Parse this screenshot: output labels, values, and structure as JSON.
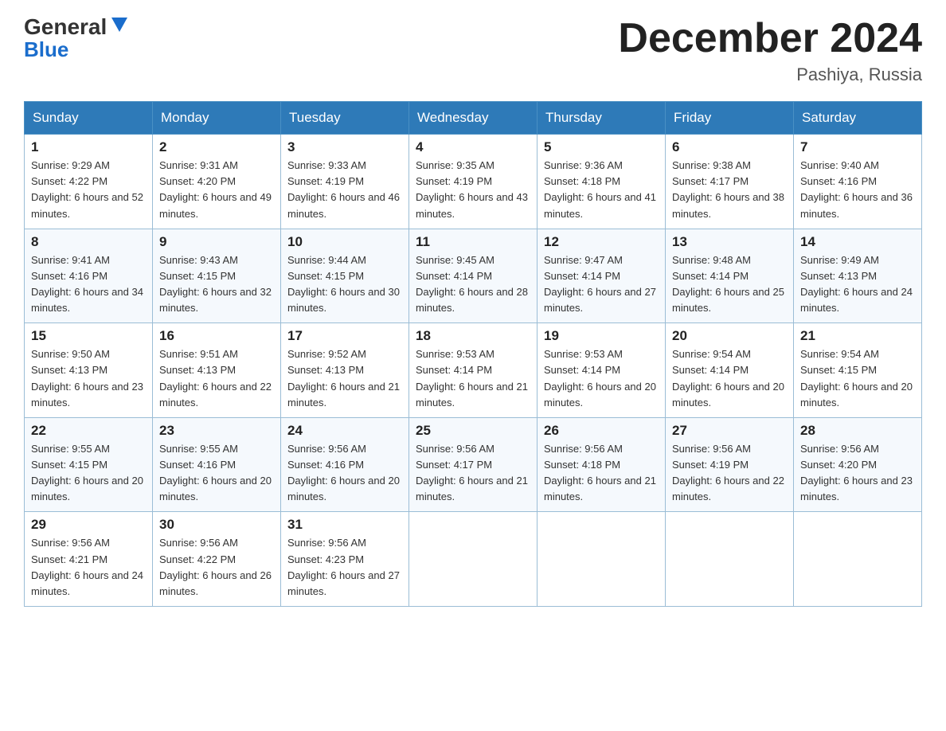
{
  "header": {
    "logo_line1": "General",
    "logo_line2": "Blue",
    "month": "December 2024",
    "location": "Pashiya, Russia"
  },
  "days_of_week": [
    "Sunday",
    "Monday",
    "Tuesday",
    "Wednesday",
    "Thursday",
    "Friday",
    "Saturday"
  ],
  "weeks": [
    [
      {
        "day": "1",
        "sunrise": "9:29 AM",
        "sunset": "4:22 PM",
        "daylight": "6 hours and 52 minutes."
      },
      {
        "day": "2",
        "sunrise": "9:31 AM",
        "sunset": "4:20 PM",
        "daylight": "6 hours and 49 minutes."
      },
      {
        "day": "3",
        "sunrise": "9:33 AM",
        "sunset": "4:19 PM",
        "daylight": "6 hours and 46 minutes."
      },
      {
        "day": "4",
        "sunrise": "9:35 AM",
        "sunset": "4:19 PM",
        "daylight": "6 hours and 43 minutes."
      },
      {
        "day": "5",
        "sunrise": "9:36 AM",
        "sunset": "4:18 PM",
        "daylight": "6 hours and 41 minutes."
      },
      {
        "day": "6",
        "sunrise": "9:38 AM",
        "sunset": "4:17 PM",
        "daylight": "6 hours and 38 minutes."
      },
      {
        "day": "7",
        "sunrise": "9:40 AM",
        "sunset": "4:16 PM",
        "daylight": "6 hours and 36 minutes."
      }
    ],
    [
      {
        "day": "8",
        "sunrise": "9:41 AM",
        "sunset": "4:16 PM",
        "daylight": "6 hours and 34 minutes."
      },
      {
        "day": "9",
        "sunrise": "9:43 AM",
        "sunset": "4:15 PM",
        "daylight": "6 hours and 32 minutes."
      },
      {
        "day": "10",
        "sunrise": "9:44 AM",
        "sunset": "4:15 PM",
        "daylight": "6 hours and 30 minutes."
      },
      {
        "day": "11",
        "sunrise": "9:45 AM",
        "sunset": "4:14 PM",
        "daylight": "6 hours and 28 minutes."
      },
      {
        "day": "12",
        "sunrise": "9:47 AM",
        "sunset": "4:14 PM",
        "daylight": "6 hours and 27 minutes."
      },
      {
        "day": "13",
        "sunrise": "9:48 AM",
        "sunset": "4:14 PM",
        "daylight": "6 hours and 25 minutes."
      },
      {
        "day": "14",
        "sunrise": "9:49 AM",
        "sunset": "4:13 PM",
        "daylight": "6 hours and 24 minutes."
      }
    ],
    [
      {
        "day": "15",
        "sunrise": "9:50 AM",
        "sunset": "4:13 PM",
        "daylight": "6 hours and 23 minutes."
      },
      {
        "day": "16",
        "sunrise": "9:51 AM",
        "sunset": "4:13 PM",
        "daylight": "6 hours and 22 minutes."
      },
      {
        "day": "17",
        "sunrise": "9:52 AM",
        "sunset": "4:13 PM",
        "daylight": "6 hours and 21 minutes."
      },
      {
        "day": "18",
        "sunrise": "9:53 AM",
        "sunset": "4:14 PM",
        "daylight": "6 hours and 21 minutes."
      },
      {
        "day": "19",
        "sunrise": "9:53 AM",
        "sunset": "4:14 PM",
        "daylight": "6 hours and 20 minutes."
      },
      {
        "day": "20",
        "sunrise": "9:54 AM",
        "sunset": "4:14 PM",
        "daylight": "6 hours and 20 minutes."
      },
      {
        "day": "21",
        "sunrise": "9:54 AM",
        "sunset": "4:15 PM",
        "daylight": "6 hours and 20 minutes."
      }
    ],
    [
      {
        "day": "22",
        "sunrise": "9:55 AM",
        "sunset": "4:15 PM",
        "daylight": "6 hours and 20 minutes."
      },
      {
        "day": "23",
        "sunrise": "9:55 AM",
        "sunset": "4:16 PM",
        "daylight": "6 hours and 20 minutes."
      },
      {
        "day": "24",
        "sunrise": "9:56 AM",
        "sunset": "4:16 PM",
        "daylight": "6 hours and 20 minutes."
      },
      {
        "day": "25",
        "sunrise": "9:56 AM",
        "sunset": "4:17 PM",
        "daylight": "6 hours and 21 minutes."
      },
      {
        "day": "26",
        "sunrise": "9:56 AM",
        "sunset": "4:18 PM",
        "daylight": "6 hours and 21 minutes."
      },
      {
        "day": "27",
        "sunrise": "9:56 AM",
        "sunset": "4:19 PM",
        "daylight": "6 hours and 22 minutes."
      },
      {
        "day": "28",
        "sunrise": "9:56 AM",
        "sunset": "4:20 PM",
        "daylight": "6 hours and 23 minutes."
      }
    ],
    [
      {
        "day": "29",
        "sunrise": "9:56 AM",
        "sunset": "4:21 PM",
        "daylight": "6 hours and 24 minutes."
      },
      {
        "day": "30",
        "sunrise": "9:56 AM",
        "sunset": "4:22 PM",
        "daylight": "6 hours and 26 minutes."
      },
      {
        "day": "31",
        "sunrise": "9:56 AM",
        "sunset": "4:23 PM",
        "daylight": "6 hours and 27 minutes."
      },
      null,
      null,
      null,
      null
    ]
  ]
}
